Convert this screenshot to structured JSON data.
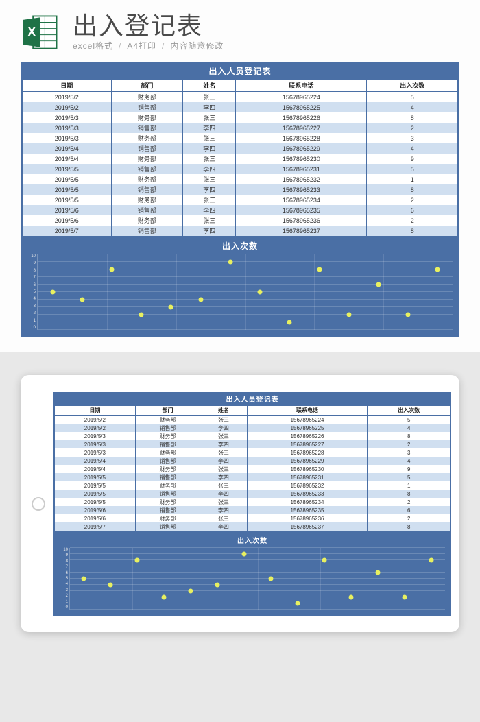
{
  "header": {
    "title": "出入登记表",
    "sub1": "excel格式",
    "sub2": "A4打印",
    "sub3": "内容随意修改"
  },
  "sheet": {
    "title": "出入人员登记表",
    "columns": [
      "日期",
      "部门",
      "姓名",
      "联系电话",
      "出入次数"
    ],
    "rows": [
      [
        "2019/5/2",
        "财务部",
        "张三",
        "15678965224",
        "5"
      ],
      [
        "2019/5/2",
        "销售部",
        "李四",
        "15678965225",
        "4"
      ],
      [
        "2019/5/3",
        "财务部",
        "张三",
        "15678965226",
        "8"
      ],
      [
        "2019/5/3",
        "销售部",
        "李四",
        "15678965227",
        "2"
      ],
      [
        "2019/5/3",
        "财务部",
        "张三",
        "15678965228",
        "3"
      ],
      [
        "2019/5/4",
        "销售部",
        "李四",
        "15678965229",
        "4"
      ],
      [
        "2019/5/4",
        "财务部",
        "张三",
        "15678965230",
        "9"
      ],
      [
        "2019/5/5",
        "销售部",
        "李四",
        "15678965231",
        "5"
      ],
      [
        "2019/5/5",
        "财务部",
        "张三",
        "15678965232",
        "1"
      ],
      [
        "2019/5/5",
        "销售部",
        "李四",
        "15678965233",
        "8"
      ],
      [
        "2019/5/5",
        "财务部",
        "张三",
        "15678965234",
        "2"
      ],
      [
        "2019/5/6",
        "销售部",
        "李四",
        "15678965235",
        "6"
      ],
      [
        "2019/5/6",
        "财务部",
        "张三",
        "15678965236",
        "2"
      ],
      [
        "2019/5/7",
        "销售部",
        "李四",
        "15678965237",
        "8"
      ]
    ]
  },
  "chart_data": {
    "type": "scatter",
    "title": "出入次数",
    "ylabel": "",
    "xlabel": "",
    "ylim": [
      0,
      10
    ],
    "yticks": [
      0,
      1,
      2,
      3,
      4,
      5,
      6,
      7,
      8,
      9,
      10
    ],
    "x": [
      1,
      2,
      3,
      4,
      5,
      6,
      7,
      8,
      9,
      10,
      11,
      12,
      13,
      14
    ],
    "values": [
      5,
      4,
      8,
      2,
      3,
      4,
      9,
      5,
      1,
      8,
      2,
      6,
      2,
      8
    ]
  }
}
